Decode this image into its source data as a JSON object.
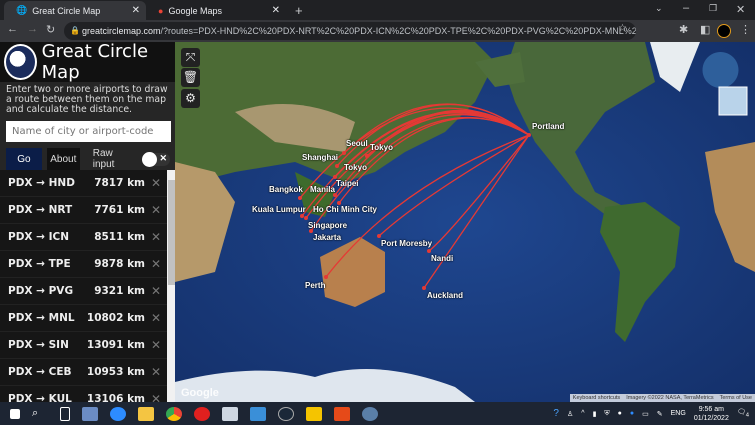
{
  "browser": {
    "tabs": [
      {
        "title": "Great Circle Map",
        "active": true
      },
      {
        "title": "Google Maps",
        "active": false
      }
    ],
    "url_host": "greatcirclemap.com",
    "url_rest": "/?routes=PDX-HND%2C%20PDX-NRT%2C%20PDX-ICN%2C%20PDX-TPE%2C%20PDX-PVG%2C%20PDX-MNL%2C%20PDX-..."
  },
  "sidebar": {
    "title": "Great Circle Map",
    "description": "Enter two or more airports to draw a route between them on the map and calculate the distance.",
    "search_placeholder": "Name of city or airport-code",
    "go_label": "Go",
    "about_label": "About",
    "raw_input_label": "Raw input",
    "raw_input_on": false,
    "routes": [
      {
        "route": "PDX → HND",
        "distance": "7817 km"
      },
      {
        "route": "PDX → NRT",
        "distance": "7761 km"
      },
      {
        "route": "PDX → ICN",
        "distance": "8511 km"
      },
      {
        "route": "PDX → TPE",
        "distance": "9878 km"
      },
      {
        "route": "PDX → PVG",
        "distance": "9321 km"
      },
      {
        "route": "PDX → MNL",
        "distance": "10802 km"
      },
      {
        "route": "PDX → SIN",
        "distance": "13091 km"
      },
      {
        "route": "PDX → CEB",
        "distance": "10953 km"
      },
      {
        "route": "PDX → KUL",
        "distance": "13106 km"
      }
    ]
  },
  "map": {
    "route_color": "#e53935",
    "labels": [
      "Portland",
      "Seoul",
      "Tokyo",
      "Shanghai",
      "Tokyo",
      "Taipei",
      "Manila",
      "Bangkok",
      "Kuala Lumpur",
      "Ho Chi Minh City",
      "Singapore",
      "Jakarta",
      "Port Moresby",
      "Nandi",
      "Perth",
      "Auckland"
    ],
    "google": "Google",
    "attribution": [
      "Keyboard shortcuts",
      "Imagery ©2022 NASA, TerraMetrics",
      "Terms of Use"
    ]
  },
  "taskbar": {
    "lang": "ENG",
    "time": "9:56 am",
    "date": "01/12/2022",
    "notifications": "4"
  }
}
